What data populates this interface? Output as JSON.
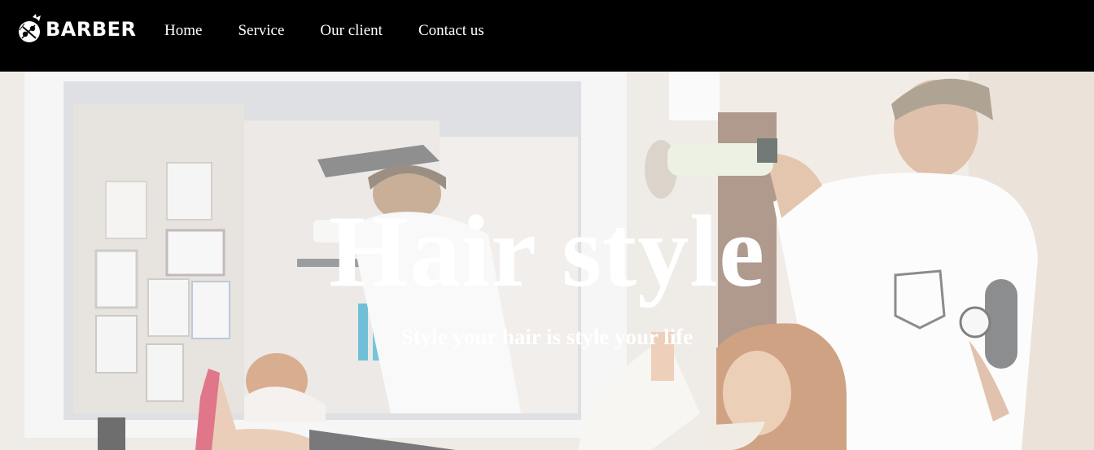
{
  "brand": {
    "name": "BARBER",
    "logo_icon": "scissors-comb-icon"
  },
  "nav": {
    "items": [
      {
        "label": "Home"
      },
      {
        "label": "Service"
      },
      {
        "label": "Our client"
      },
      {
        "label": "Contact us"
      }
    ]
  },
  "hero": {
    "title": "Hair style",
    "subtitle": "Style your hair is style your life",
    "image": "barber-salon-photo"
  },
  "colors": {
    "navbar_bg": "#000000",
    "text": "#ffffff"
  }
}
